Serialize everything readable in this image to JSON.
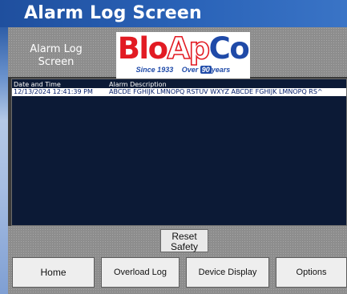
{
  "window": {
    "title": "Alarm Log Screen"
  },
  "header": {
    "screen_label_line1": "Alarm Log",
    "screen_label_line2": "Screen",
    "logo": {
      "part1": "Blo",
      "part2": "Ap",
      "part3": "Co",
      "tag_since": "Since 1933",
      "tag_over_pre": "Over",
      "tag_over_num": "90",
      "tag_over_post": "years"
    }
  },
  "alarm_log": {
    "columns": {
      "date_time": "Date and Time",
      "description": "Alarm Description"
    },
    "rows": [
      {
        "date_time": "12/13/2024 12:41:39 PM",
        "description": "ABCDE FGHIJK LMNOPQ RSTUV WXYZ ABCDE FGHIJK LMNOPQ RS^"
      }
    ]
  },
  "controls": {
    "reset_line1": "Reset",
    "reset_line2": "Safety"
  },
  "nav": {
    "home": "Home",
    "overload_log": "Overload Log",
    "device_display": "Device Display",
    "options": "Options"
  },
  "colors": {
    "title_blue": "#2a5aa8",
    "log_bg": "#0c1a36",
    "panel_gray": "#8d8d8d",
    "brand_red": "#e21b23",
    "brand_blue": "#1f4aa8"
  }
}
